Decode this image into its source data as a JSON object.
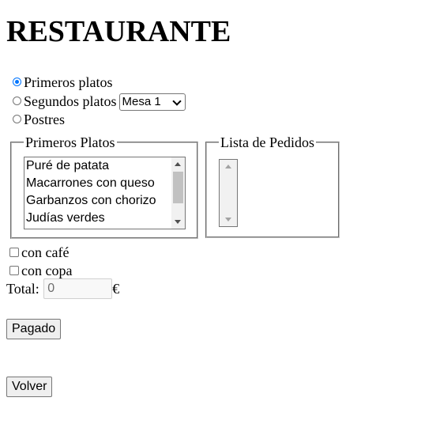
{
  "page": {
    "title": "RESTAURANTE"
  },
  "menu_type": {
    "options": [
      {
        "label": "Primeros platos",
        "checked": true
      },
      {
        "label": "Segundos platos",
        "checked": false
      },
      {
        "label": "Postres",
        "checked": false
      }
    ],
    "mesa_select": {
      "value": "Mesa 1"
    }
  },
  "platos": {
    "legend": "Primeros Platos",
    "items": [
      "Puré de patata",
      "Macarrones con queso",
      "Garbanzos con chorizo",
      "Judías verdes"
    ]
  },
  "pedidos": {
    "legend": "Lista de Pedidos",
    "items": []
  },
  "extras": {
    "cafe_label": "con café",
    "copa_label": "con copa"
  },
  "total": {
    "label": "Total:",
    "value": "0",
    "currency": "€"
  },
  "buttons": {
    "pagado": "Pagado",
    "volver": "Volver"
  },
  "colors": {
    "radio_accent": "#0075ff",
    "button_bg": "#efefef"
  }
}
